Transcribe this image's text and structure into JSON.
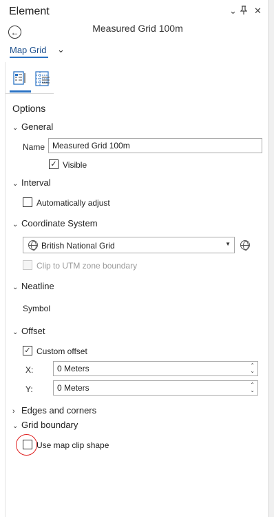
{
  "window": {
    "title": "Element",
    "menu_glyph": "⌄",
    "pin_glyph": "📌",
    "close_glyph": "✕"
  },
  "header": {
    "back_glyph": "←",
    "element_name": "Measured Grid 100m",
    "element_type": "Map Grid",
    "dropdown_glyph": "⌄"
  },
  "tabs": [
    {
      "name": "properties-tab-icon"
    },
    {
      "name": "table-tab-icon"
    }
  ],
  "options_label": "Options",
  "sections": {
    "general": "General",
    "interval": "Interval",
    "coordinate_system": "Coordinate System",
    "neatline": "Neatline",
    "offset": "Offset",
    "edges_corners": "Edges and corners",
    "grid_boundary": "Grid boundary"
  },
  "general": {
    "name_label": "Name",
    "name_value": "Measured Grid 100m",
    "visible_label": "Visible",
    "visible_checked": true
  },
  "interval": {
    "auto_adjust_label": "Automatically adjust",
    "auto_adjust_checked": false
  },
  "coordinate_system": {
    "selected": "British National Grid",
    "clip_utm_label": "Clip to UTM zone boundary",
    "clip_utm_checked": false,
    "clip_utm_disabled": true
  },
  "neatline": {
    "symbol_label": "Symbol"
  },
  "offset": {
    "custom_offset_label": "Custom offset",
    "custom_offset_checked": true,
    "x_label": "X:",
    "x_value": "0 Meters",
    "y_label": "Y:",
    "y_value": "0 Meters"
  },
  "grid_boundary": {
    "use_clip_label": "Use map clip shape",
    "use_clip_checked": false
  },
  "colors": {
    "accent": "#2a72c4",
    "annotation": "#e02020"
  }
}
